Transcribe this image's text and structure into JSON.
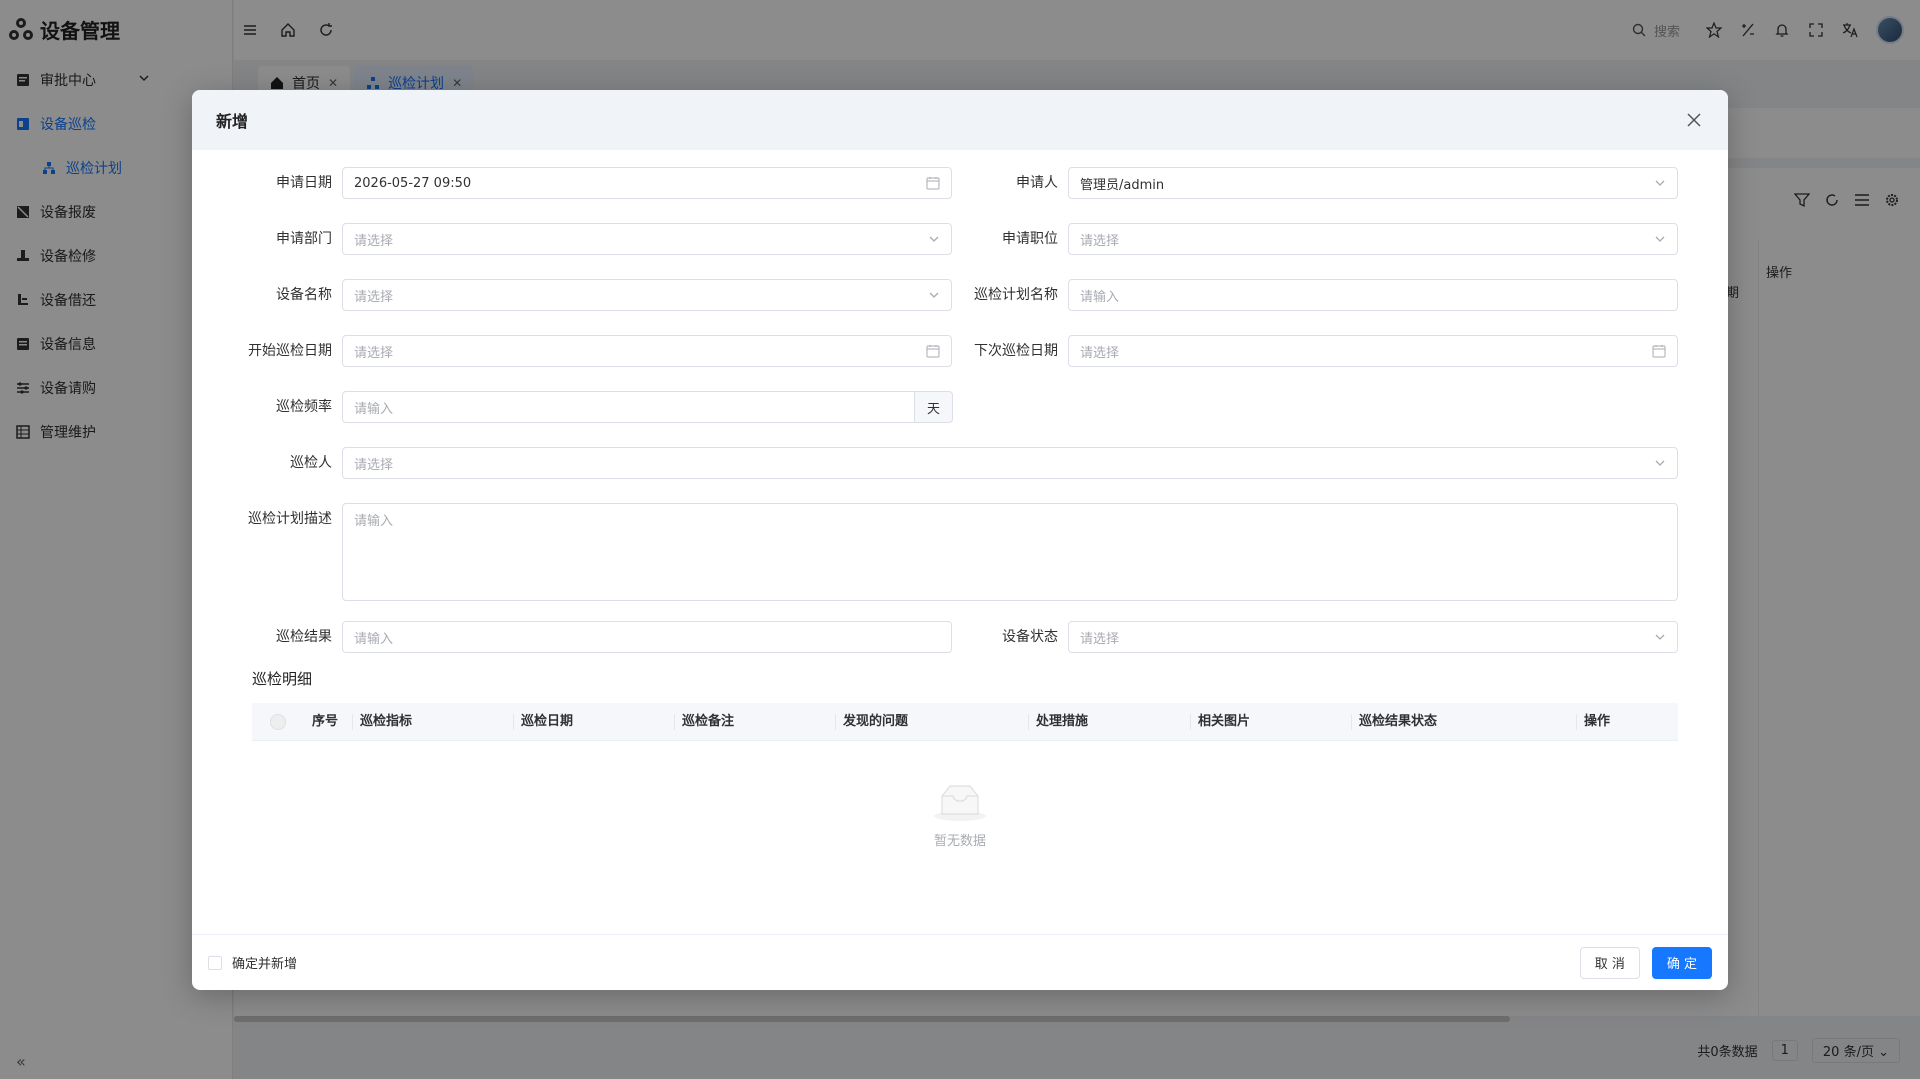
{
  "app": {
    "title": "设备管理"
  },
  "sidebar": {
    "items": [
      {
        "label": "审批中心",
        "icon": "approval-icon"
      },
      {
        "label": "设备巡检",
        "icon": "inspection-icon"
      },
      {
        "label": "巡检计划",
        "icon": "plan-icon"
      },
      {
        "label": "设备报废",
        "icon": "scrap-icon"
      },
      {
        "label": "设备检修",
        "icon": "repair-icon"
      },
      {
        "label": "设备借还",
        "icon": "borrow-icon"
      },
      {
        "label": "设备信息",
        "icon": "info-icon"
      },
      {
        "label": "设备请购",
        "icon": "purchase-icon"
      },
      {
        "label": "管理维护",
        "icon": "maintain-icon"
      }
    ],
    "collapse": "«"
  },
  "header": {
    "search_label": "搜索"
  },
  "tabs": [
    {
      "label": "首页"
    },
    {
      "label": "巡检计划"
    }
  ],
  "background": {
    "op_header": "操作",
    "partial_header": "期",
    "total": "共0条数据",
    "page": "1",
    "page_size": "20 条/页"
  },
  "modal": {
    "title": "新增",
    "fields": {
      "apply_date": {
        "label": "申请日期",
        "value": "2026-05-27 09:50"
      },
      "applicant": {
        "label": "申请人",
        "value": "管理员/admin"
      },
      "apply_dept": {
        "label": "申请部门",
        "placeholder": "请选择"
      },
      "apply_post": {
        "label": "申请职位",
        "placeholder": "请选择"
      },
      "device_name": {
        "label": "设备名称",
        "placeholder": "请选择"
      },
      "plan_name": {
        "label": "巡检计划名称",
        "placeholder": "请输入"
      },
      "start_date": {
        "label": "开始巡检日期",
        "placeholder": "请选择"
      },
      "next_date": {
        "label": "下次巡检日期",
        "placeholder": "请选择"
      },
      "frequency": {
        "label": "巡检频率",
        "placeholder": "请输入",
        "unit": "天"
      },
      "inspector": {
        "label": "巡检人",
        "placeholder": "请选择"
      },
      "description": {
        "label": "巡检计划描述",
        "placeholder": "请输入"
      },
      "result": {
        "label": "巡检结果",
        "placeholder": "请输入"
      },
      "device_status": {
        "label": "设备状态",
        "placeholder": "请选择"
      }
    },
    "detail": {
      "title": "巡检明细",
      "columns": [
        "序号",
        "巡检指标",
        "巡检日期",
        "巡检备注",
        "发现的问题",
        "处理措施",
        "相关图片",
        "巡检结果状态",
        "操作"
      ],
      "empty": "暂无数据"
    },
    "footer": {
      "confirm_add": "确定并新增",
      "cancel": "取 消",
      "ok": "确 定"
    }
  }
}
